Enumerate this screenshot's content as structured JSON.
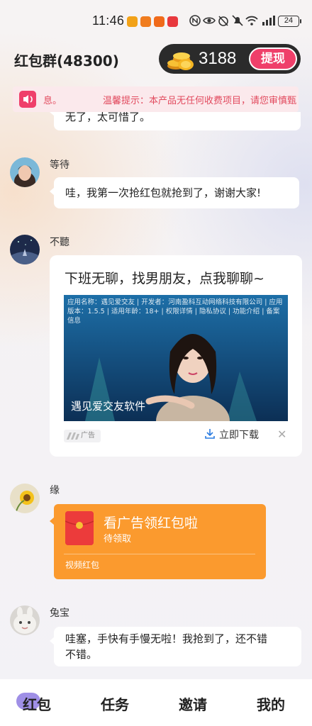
{
  "status_bar": {
    "time": "11:46",
    "battery": "24"
  },
  "header": {
    "group_title": "红包群(48300)",
    "coin_count": "3188",
    "withdraw_label": "提现"
  },
  "notice": {
    "prefix": "息。",
    "text": "温馨提示：本产品无任何收费项目，请您审慎甄"
  },
  "messages": [
    {
      "sender": "",
      "text": "无了，太可惜了。"
    },
    {
      "sender": "等待",
      "text": "哇，我第一次抢红包就抢到了，谢谢大家!"
    },
    {
      "sender": "不聽",
      "ad": {
        "headline": "下班无聊，找男朋友，点我聊聊~",
        "meta": "应用名称：遇见爱交友 | 开发者：河南盈科互动网络科技有限公司 | 应用版本：1.5.5 | 适用年龄：18+ | 权限详情 | 隐私协议 | 功能介绍 | 备案信息",
        "image_caption": "遇见爱交友软件",
        "tag": "广告",
        "download_label": "立即下载",
        "close_glyph": "✕"
      }
    },
    {
      "sender": "缘",
      "red_packet": {
        "title": "看广告领红包啦",
        "status": "待领取",
        "label": "视频红包"
      }
    },
    {
      "sender": "兔宝",
      "text_line1": "哇塞，手快有手慢无啦！我抢到了，还不错",
      "text_line2": "不错。"
    }
  ],
  "tabs": [
    {
      "label": "红包",
      "active": true
    },
    {
      "label": "任务",
      "active": false
    },
    {
      "label": "邀请",
      "active": false
    },
    {
      "label": "我的",
      "active": false
    }
  ],
  "colors": {
    "accent": "#ef3f6a",
    "red_packet": "#fb9a2e",
    "tab_active": "#9f8fe6"
  }
}
